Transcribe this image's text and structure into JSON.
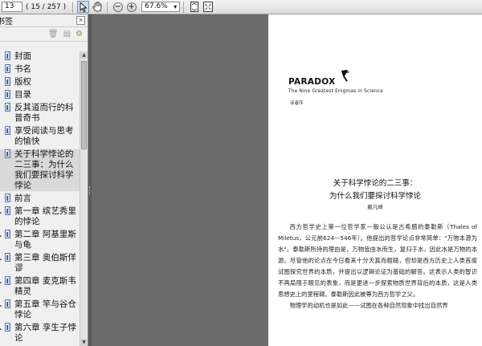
{
  "toolbar": {
    "page_current": "13",
    "page_label": "( 15 / 257 )",
    "zoom_value": "67.6%",
    "zoom_arrow": "▾"
  },
  "sidebar": {
    "title": "书签",
    "close_symbol": "×",
    "bookmarks": [
      {
        "label": "封面"
      },
      {
        "label": "书名"
      },
      {
        "label": "版权"
      },
      {
        "label": "目录"
      },
      {
        "label": "反其道而行的科普奇书"
      },
      {
        "label": "享受阅读与思考的愉快"
      },
      {
        "label": "关于科学悖论的二三事：为什么我们要探讨科学悖论"
      },
      {
        "label": "前言"
      },
      {
        "label": "第一章 缤艺秀里的悖论"
      },
      {
        "label": "第二章 阿基里斯与龟"
      },
      {
        "label": "第三章 奥伯斯佯谬"
      },
      {
        "label": "第四章 麦克斯韦精灵"
      },
      {
        "label": "第五章 竿与谷仓悖论"
      },
      {
        "label": "第六章 孪生子悖论"
      }
    ]
  },
  "page": {
    "logo_text": "PARADOX",
    "logo_subtitle": "The Nine Greatest Enigmas in Science",
    "logo_author": "译者序",
    "title_line1": "关于科学悖论的二三事：",
    "title_line2": "为什么我们要探讨科学悖论",
    "author": "戴凡峰",
    "paragraph1": "西方哲学史上第一位哲学家一般公认是古希腊的泰勒斯（Thales of Miletus，公元前624—546年）。他提出的哲学论点非常简单：\"万物本源为水\"。泰勒斯所持的理由是，万物皆由水而生，复归于水，因此水是万物的本源。尽管他的论点在今日看来十分天真而粗糙，但却是西方历史上人类首度试图探究世界的本质，并提出以逻辑论证为基础的解答。这表示人类的智识不再局限于眼见的表象，而是更进一步探索物质世界背后的本质，这是人类思想史上的里程碑。泰勒斯因此被尊为西方哲学之父。",
    "paragraph2": "物理学的动机也是如此——试图在各种自然现象中找出自然界"
  }
}
